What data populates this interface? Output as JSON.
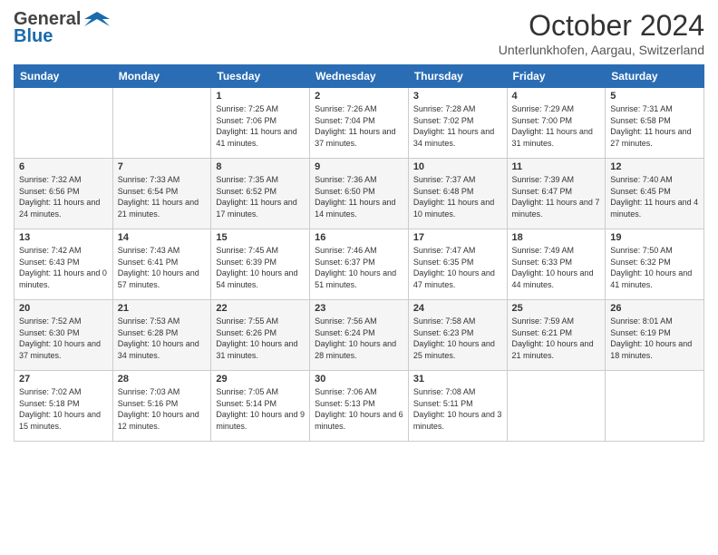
{
  "logo": {
    "general": "General",
    "blue": "Blue"
  },
  "title": "October 2024",
  "subtitle": "Unterlunkhofen, Aargau, Switzerland",
  "days_of_week": [
    "Sunday",
    "Monday",
    "Tuesday",
    "Wednesday",
    "Thursday",
    "Friday",
    "Saturday"
  ],
  "weeks": [
    [
      {
        "day": "",
        "info": ""
      },
      {
        "day": "",
        "info": ""
      },
      {
        "day": "1",
        "info": "Sunrise: 7:25 AM\nSunset: 7:06 PM\nDaylight: 11 hours and 41 minutes."
      },
      {
        "day": "2",
        "info": "Sunrise: 7:26 AM\nSunset: 7:04 PM\nDaylight: 11 hours and 37 minutes."
      },
      {
        "day": "3",
        "info": "Sunrise: 7:28 AM\nSunset: 7:02 PM\nDaylight: 11 hours and 34 minutes."
      },
      {
        "day": "4",
        "info": "Sunrise: 7:29 AM\nSunset: 7:00 PM\nDaylight: 11 hours and 31 minutes."
      },
      {
        "day": "5",
        "info": "Sunrise: 7:31 AM\nSunset: 6:58 PM\nDaylight: 11 hours and 27 minutes."
      }
    ],
    [
      {
        "day": "6",
        "info": "Sunrise: 7:32 AM\nSunset: 6:56 PM\nDaylight: 11 hours and 24 minutes."
      },
      {
        "day": "7",
        "info": "Sunrise: 7:33 AM\nSunset: 6:54 PM\nDaylight: 11 hours and 21 minutes."
      },
      {
        "day": "8",
        "info": "Sunrise: 7:35 AM\nSunset: 6:52 PM\nDaylight: 11 hours and 17 minutes."
      },
      {
        "day": "9",
        "info": "Sunrise: 7:36 AM\nSunset: 6:50 PM\nDaylight: 11 hours and 14 minutes."
      },
      {
        "day": "10",
        "info": "Sunrise: 7:37 AM\nSunset: 6:48 PM\nDaylight: 11 hours and 10 minutes."
      },
      {
        "day": "11",
        "info": "Sunrise: 7:39 AM\nSunset: 6:47 PM\nDaylight: 11 hours and 7 minutes."
      },
      {
        "day": "12",
        "info": "Sunrise: 7:40 AM\nSunset: 6:45 PM\nDaylight: 11 hours and 4 minutes."
      }
    ],
    [
      {
        "day": "13",
        "info": "Sunrise: 7:42 AM\nSunset: 6:43 PM\nDaylight: 11 hours and 0 minutes."
      },
      {
        "day": "14",
        "info": "Sunrise: 7:43 AM\nSunset: 6:41 PM\nDaylight: 10 hours and 57 minutes."
      },
      {
        "day": "15",
        "info": "Sunrise: 7:45 AM\nSunset: 6:39 PM\nDaylight: 10 hours and 54 minutes."
      },
      {
        "day": "16",
        "info": "Sunrise: 7:46 AM\nSunset: 6:37 PM\nDaylight: 10 hours and 51 minutes."
      },
      {
        "day": "17",
        "info": "Sunrise: 7:47 AM\nSunset: 6:35 PM\nDaylight: 10 hours and 47 minutes."
      },
      {
        "day": "18",
        "info": "Sunrise: 7:49 AM\nSunset: 6:33 PM\nDaylight: 10 hours and 44 minutes."
      },
      {
        "day": "19",
        "info": "Sunrise: 7:50 AM\nSunset: 6:32 PM\nDaylight: 10 hours and 41 minutes."
      }
    ],
    [
      {
        "day": "20",
        "info": "Sunrise: 7:52 AM\nSunset: 6:30 PM\nDaylight: 10 hours and 37 minutes."
      },
      {
        "day": "21",
        "info": "Sunrise: 7:53 AM\nSunset: 6:28 PM\nDaylight: 10 hours and 34 minutes."
      },
      {
        "day": "22",
        "info": "Sunrise: 7:55 AM\nSunset: 6:26 PM\nDaylight: 10 hours and 31 minutes."
      },
      {
        "day": "23",
        "info": "Sunrise: 7:56 AM\nSunset: 6:24 PM\nDaylight: 10 hours and 28 minutes."
      },
      {
        "day": "24",
        "info": "Sunrise: 7:58 AM\nSunset: 6:23 PM\nDaylight: 10 hours and 25 minutes."
      },
      {
        "day": "25",
        "info": "Sunrise: 7:59 AM\nSunset: 6:21 PM\nDaylight: 10 hours and 21 minutes."
      },
      {
        "day": "26",
        "info": "Sunrise: 8:01 AM\nSunset: 6:19 PM\nDaylight: 10 hours and 18 minutes."
      }
    ],
    [
      {
        "day": "27",
        "info": "Sunrise: 7:02 AM\nSunset: 5:18 PM\nDaylight: 10 hours and 15 minutes."
      },
      {
        "day": "28",
        "info": "Sunrise: 7:03 AM\nSunset: 5:16 PM\nDaylight: 10 hours and 12 minutes."
      },
      {
        "day": "29",
        "info": "Sunrise: 7:05 AM\nSunset: 5:14 PM\nDaylight: 10 hours and 9 minutes."
      },
      {
        "day": "30",
        "info": "Sunrise: 7:06 AM\nSunset: 5:13 PM\nDaylight: 10 hours and 6 minutes."
      },
      {
        "day": "31",
        "info": "Sunrise: 7:08 AM\nSunset: 5:11 PM\nDaylight: 10 hours and 3 minutes."
      },
      {
        "day": "",
        "info": ""
      },
      {
        "day": "",
        "info": ""
      }
    ]
  ]
}
